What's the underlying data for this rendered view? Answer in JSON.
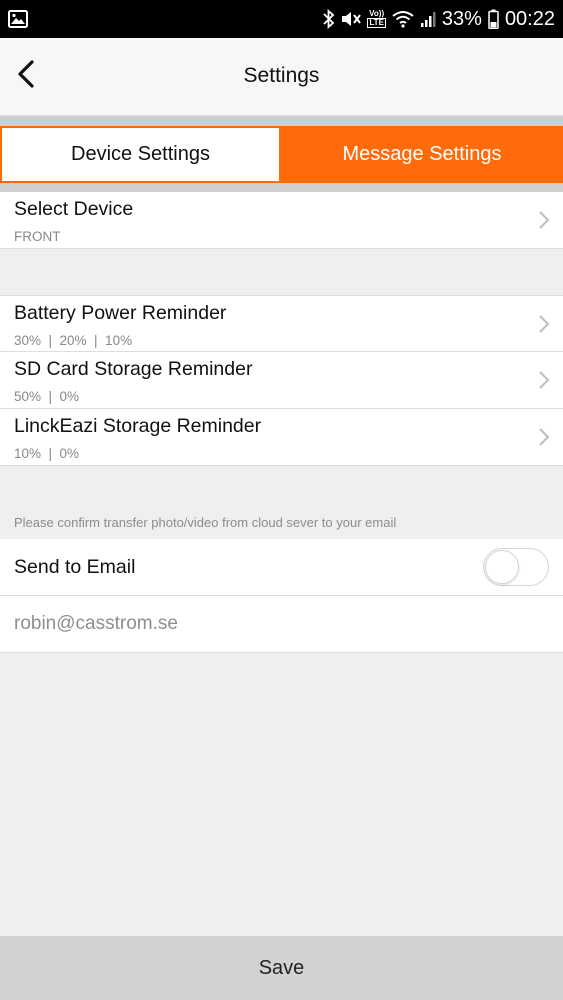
{
  "status_bar": {
    "left_icon": "image-icon",
    "icons": [
      "bluetooth-icon",
      "mute-icon",
      "volte-icon",
      "wifi-icon",
      "signal-icon"
    ],
    "volte_top": "Vo))",
    "volte_bottom": "LTE",
    "battery_percent": "33%",
    "battery_icon": "battery-icon",
    "time": "00:22"
  },
  "header": {
    "back_icon": "chevron-left-icon",
    "title": "Settings"
  },
  "tabs": [
    {
      "label": "Device Settings",
      "active": false
    },
    {
      "label": "Message Settings",
      "active": true
    }
  ],
  "device_row": {
    "title": "Select Device",
    "value": "FRONT"
  },
  "reminders": [
    {
      "title": "Battery Power Reminder",
      "values": "30%  |  20%  |  10%"
    },
    {
      "title": "SD Card Storage Reminder",
      "values": "50%  |  0%"
    },
    {
      "title": "LinckEazi Storage Reminder",
      "values": "10%  |  0%"
    }
  ],
  "email_section": {
    "note": "Please confirm transfer photo/video from cloud sever to your email",
    "send_label": "Send to Email",
    "send_enabled": false,
    "email_value": "robin@casstrom.se"
  },
  "footer": {
    "save_label": "Save"
  },
  "colors": {
    "accent": "#ff6a0a",
    "background": "#efefef",
    "status_bar": "#000000",
    "save_bar": "#d2d2d2"
  }
}
